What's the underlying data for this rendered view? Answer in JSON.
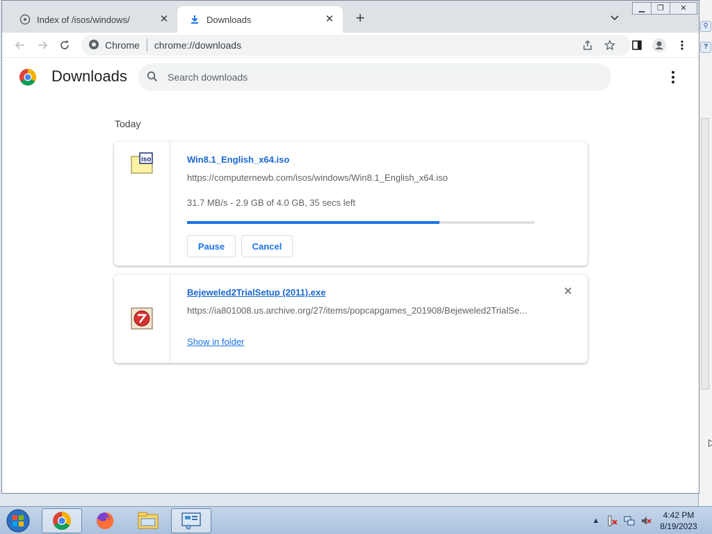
{
  "tabs": [
    {
      "title": "Index of /isos/windows/",
      "active": false,
      "icon": "page-icon"
    },
    {
      "title": "Downloads",
      "active": true,
      "icon": "download-icon"
    }
  ],
  "toolbar": {
    "site_label": "Chrome",
    "url": "chrome://downloads"
  },
  "downloads_page": {
    "title": "Downloads",
    "search_placeholder": "Search downloads",
    "date_group": "Today",
    "items": [
      {
        "filename": "Win8.1_English_x64.iso",
        "source": "https://computernewb.com/isos/windows/Win8.1_English_x64.iso",
        "status": "31.7 MB/s - 2.9 GB of 4.0 GB, 35 secs left",
        "progress_fraction": 0.725,
        "pause_label": "Pause",
        "cancel_label": "Cancel",
        "icon": "iso-file-icon"
      },
      {
        "filename": "Bejeweled2TrialSetup (2011).exe",
        "source": "https://ia801008.us.archive.org/27/items/popcapgames_201908/Bejeweled2TrialSe...",
        "show_in_folder_label": "Show in folder",
        "icon": "bejeweled-app-icon"
      }
    ]
  },
  "taskbar": {
    "time": "4:42 PM",
    "date": "8/19/2023",
    "apps": [
      "chrome-icon",
      "firefox-icon",
      "file-explorer-icon",
      "control-panel-icon"
    ]
  },
  "colors": {
    "accent": "#1a73e8",
    "tab_strip": "#dee1e6",
    "taskbar": "#b8cce4"
  }
}
